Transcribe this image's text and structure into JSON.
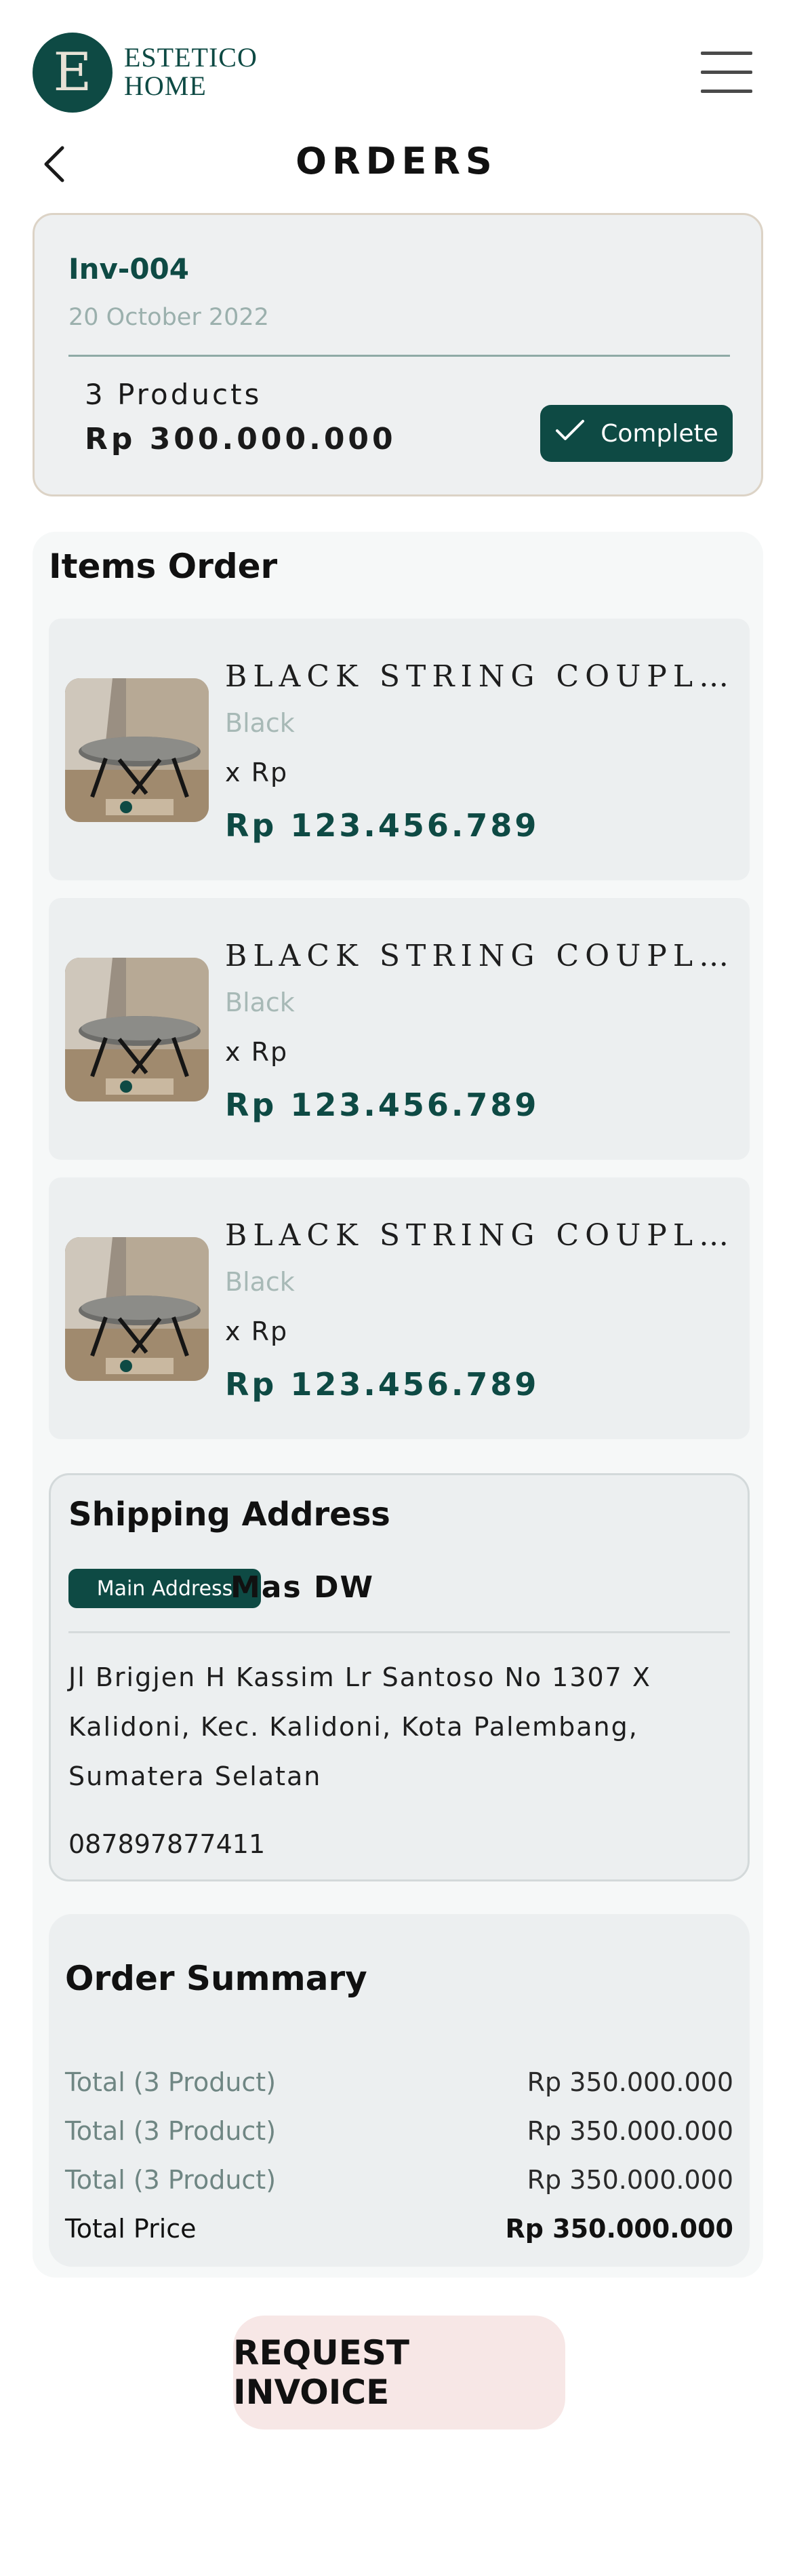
{
  "brand": {
    "logo_letter": "E",
    "name_line1": "ESTETICO",
    "name_line2": "HOME"
  },
  "icons": {
    "menu": "hamburger-menu-icon",
    "back": "chevron-left-icon",
    "status": "check-icon"
  },
  "colors": {
    "brand": "#0e4a44",
    "muted_text": "#9bb0ad",
    "card_bg": "#eceff0",
    "button_bg": "#f7e7e6"
  },
  "page": {
    "title": "ORDERS"
  },
  "invoice": {
    "id": "Inv-004",
    "date": "20 October 2022",
    "products": "3 Products",
    "total": "Rp 300.000.000",
    "status": "Complete"
  },
  "items_section": {
    "heading": "Items Order"
  },
  "items": [
    {
      "name": "BLACK STRING COUPLE COFFEE TABLE",
      "variant": "Black",
      "qty": "x Rp",
      "price": "Rp 123.456.789"
    },
    {
      "name": "BLACK STRING COUPLE COFFEE TABLE",
      "variant": "Black",
      "qty": "x Rp",
      "price": "Rp 123.456.789"
    },
    {
      "name": "BLACK STRING COUPLE COFFEE TABLE",
      "variant": "Black",
      "qty": "x Rp",
      "price": "Rp 123.456.789"
    }
  ],
  "shipping": {
    "heading": "Shipping Address",
    "badge": "Main Address",
    "name": "Mas DW",
    "address": "Jl Brigjen H Kassim Lr Santoso No 1307 X Kalidoni, Kec. Kalidoni, Kota Palembang, Sumatera Selatan",
    "phone": "087897877411"
  },
  "summary": {
    "heading": "Order Summary",
    "rows": [
      {
        "label": "Total (3 Product)",
        "value": "Rp 350.000.000"
      },
      {
        "label": "Total (3 Product)",
        "value": "Rp 350.000.000"
      },
      {
        "label": "Total (3 Product)",
        "value": "Rp 350.000.000"
      }
    ],
    "total_label": "Total Price",
    "total_value": "Rp 350.000.000"
  },
  "actions": {
    "request_invoice": "REQUEST INVOICE"
  }
}
